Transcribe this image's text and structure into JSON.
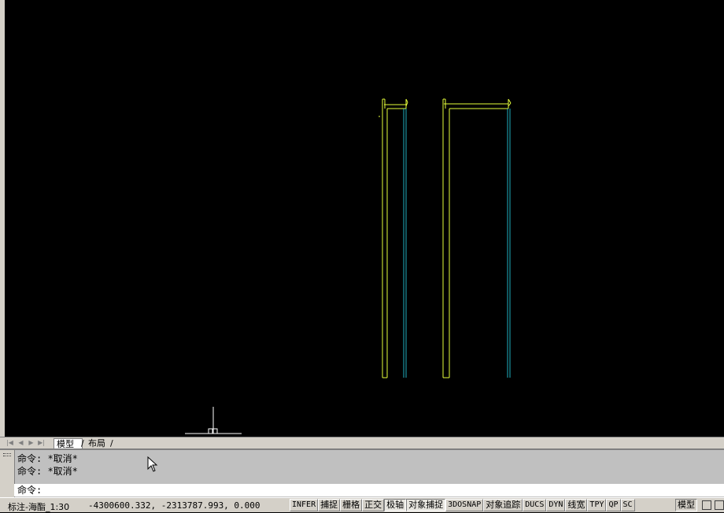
{
  "tabs": {
    "model": "模型",
    "layout": "布局"
  },
  "command": {
    "history": [
      "命令: *取消*",
      "命令: *取消*"
    ],
    "prompt": "命令:"
  },
  "status": {
    "dim_style": "标注-海酯_1:30",
    "coordinates": "-4300600.332, -2313787.993, 0.000",
    "toggles": [
      {
        "label": "INFER",
        "on": false
      },
      {
        "label": "捕捉",
        "on": false
      },
      {
        "label": "栅格",
        "on": false
      },
      {
        "label": "正交",
        "on": false
      },
      {
        "label": "极轴",
        "on": true
      },
      {
        "label": "对象捕捉",
        "on": true
      },
      {
        "label": "3DOSNAP",
        "on": false
      },
      {
        "label": "对象追踪",
        "on": false
      },
      {
        "label": "DUCS",
        "on": false
      },
      {
        "label": "DYN",
        "on": false
      },
      {
        "label": "线宽",
        "on": false
      },
      {
        "label": "TPY",
        "on": false
      },
      {
        "label": "QP",
        "on": false
      },
      {
        "label": "SC",
        "on": false
      }
    ],
    "space": "模型"
  },
  "colors": {
    "background": "#000000",
    "yellow_lines": "#e6ff3a",
    "cyan_lines": "#20b0c0",
    "ucs_icon": "#ffffff"
  }
}
